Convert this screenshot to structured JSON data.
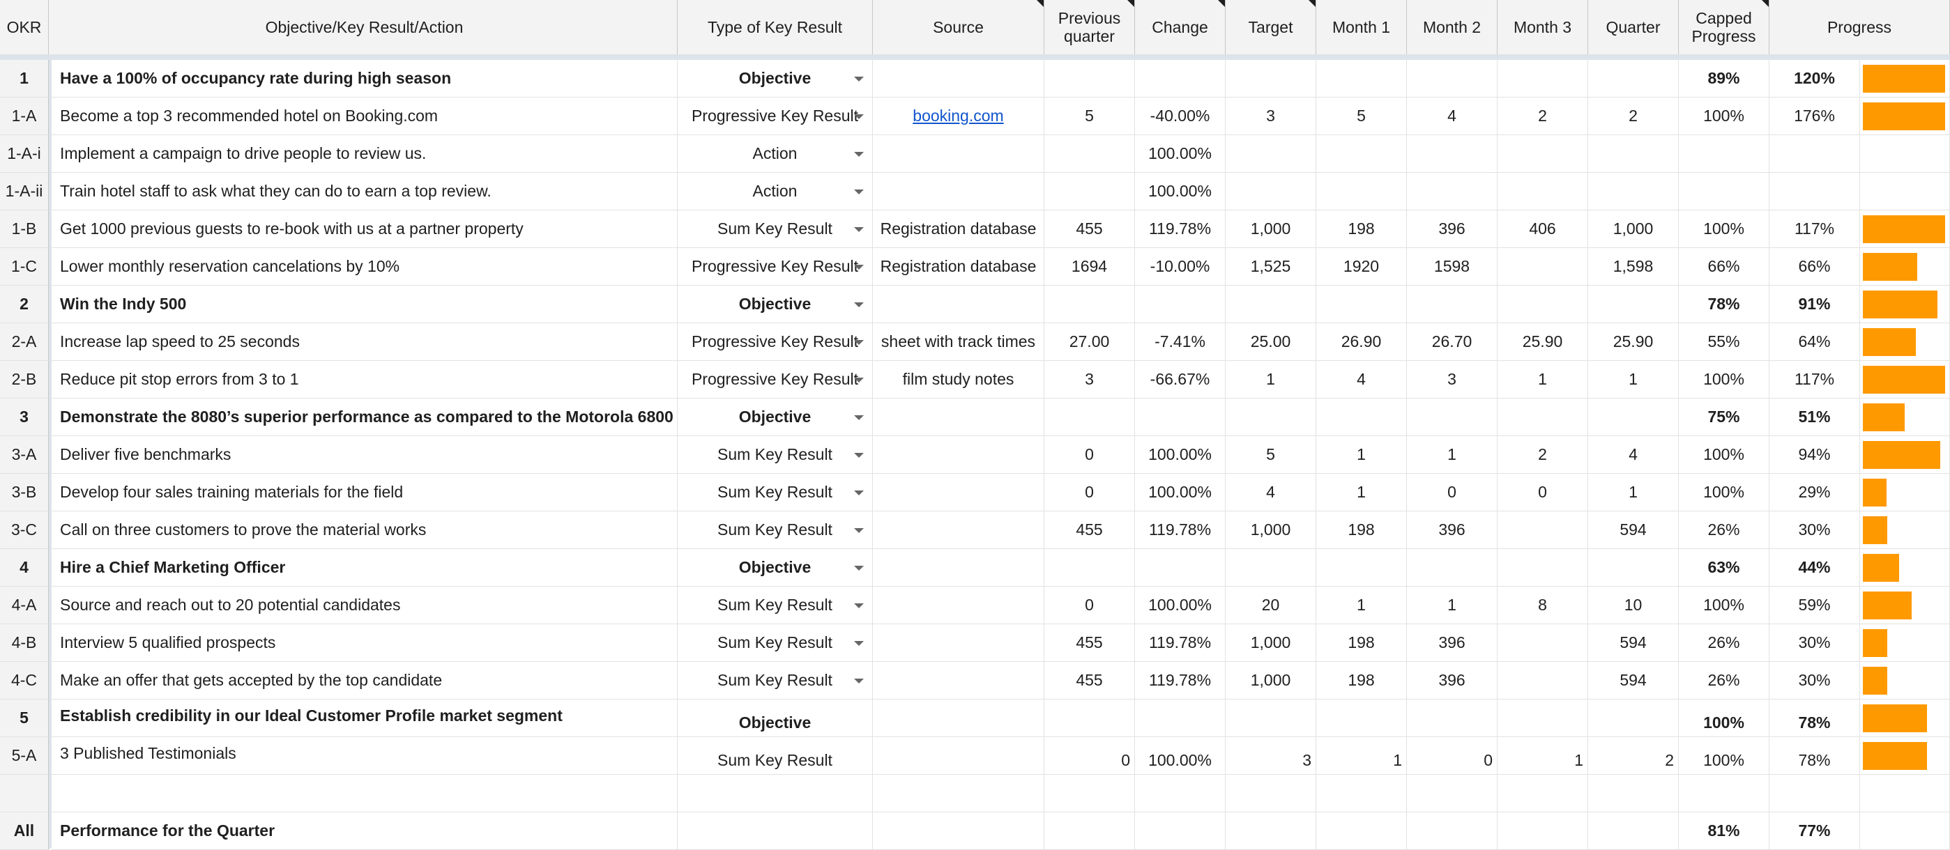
{
  "headers": {
    "okr": "OKR",
    "objective": "Objective/Key Result/Action",
    "type": "Type of Key Result",
    "source": "Source",
    "previous": "Previous\nquarter",
    "change": "Change",
    "target": "Target",
    "month1": "Month 1",
    "month2": "Month 2",
    "month3": "Month 3",
    "quarter": "Quarter",
    "capped": "Capped\nProgress",
    "progress": "Progress"
  },
  "rows": [
    {
      "id": "1",
      "name": "Have a 100% of occupancy rate during high season",
      "type": "Objective",
      "source": "",
      "prev": "",
      "change": "",
      "target": "",
      "m1": "",
      "m2": "",
      "m3": "",
      "quarter": "",
      "capped": "89%",
      "progress": "120%",
      "bar": 1.0
    },
    {
      "id": "1-A",
      "name": "Become a top 3 recommended hotel on Booking.com",
      "type": "Progressive Key Result",
      "source": "booking.com",
      "prev": "5",
      "change": "-40.00%",
      "target": "3",
      "m1": "5",
      "m2": "4",
      "m3": "2",
      "quarter": "2",
      "capped": "100%",
      "progress": "176%",
      "bar": 1.0
    },
    {
      "id": "1-A-i",
      "name": "Implement a campaign to drive people to review us.",
      "type": "Action",
      "source": "",
      "prev": "",
      "change": "100.00%",
      "target": "",
      "m1": "",
      "m2": "",
      "m3": "",
      "quarter": "",
      "capped": "",
      "progress": "",
      "bar": 0
    },
    {
      "id": "1-A-ii",
      "name": "Train hotel staff to ask what they can do to earn a top review.",
      "type": "Action",
      "source": "",
      "prev": "",
      "change": "100.00%",
      "target": "",
      "m1": "",
      "m2": "",
      "m3": "",
      "quarter": "",
      "capped": "",
      "progress": "",
      "bar": 0
    },
    {
      "id": "1-B",
      "name": "Get 1000 previous guests to re-book with us at a partner property",
      "type": "Sum Key Result",
      "source": "Registration database",
      "prev": "455",
      "change": "119.78%",
      "target": "1,000",
      "m1": "198",
      "m2": "396",
      "m3": "406",
      "quarter": "1,000",
      "capped": "100%",
      "progress": "117%",
      "bar": 1.0
    },
    {
      "id": "1-C",
      "name": "Lower monthly reservation cancelations by 10%",
      "type": "Progressive Key Result",
      "source": "Registration database",
      "prev": "1694",
      "change": "-10.00%",
      "target": "1,525",
      "m1": "1920",
      "m2": "1598",
      "m3": "",
      "quarter": "1,598",
      "capped": "66%",
      "progress": "66%",
      "bar": 0.66
    },
    {
      "id": "2",
      "name": "Win the Indy 500",
      "type": "Objective",
      "source": "",
      "prev": "",
      "change": "",
      "target": "",
      "m1": "",
      "m2": "",
      "m3": "",
      "quarter": "",
      "capped": "78%",
      "progress": "91%",
      "bar": 0.91
    },
    {
      "id": "2-A",
      "name": "Increase lap speed to 25 seconds",
      "type": "Progressive Key Result",
      "source": "sheet with track times",
      "prev": "27.00",
      "change": "-7.41%",
      "target": "25.00",
      "m1": "26.90",
      "m2": "26.70",
      "m3": "25.90",
      "quarter": "25.90",
      "capped": "55%",
      "progress": "64%",
      "bar": 0.64
    },
    {
      "id": "2-B",
      "name": "Reduce pit stop errors from 3 to 1",
      "type": "Progressive Key Result",
      "source": "film study notes",
      "prev": "3",
      "change": "-66.67%",
      "target": "1",
      "m1": "4",
      "m2": "3",
      "m3": "1",
      "quarter": "1",
      "capped": "100%",
      "progress": "117%",
      "bar": 1.0
    },
    {
      "id": "3",
      "name": "Demonstrate the 8080’s superior performance as compared to the Motorola 6800",
      "type": "Objective",
      "source": "",
      "prev": "",
      "change": "",
      "target": "",
      "m1": "",
      "m2": "",
      "m3": "",
      "quarter": "",
      "capped": "75%",
      "progress": "51%",
      "bar": 0.51
    },
    {
      "id": "3-A",
      "name": "Deliver five benchmarks",
      "type": "Sum Key Result",
      "source": "",
      "prev": "0",
      "change": "100.00%",
      "target": "5",
      "m1": "1",
      "m2": "1",
      "m3": "2",
      "quarter": "4",
      "capped": "100%",
      "progress": "94%",
      "bar": 0.94
    },
    {
      "id": "3-B",
      "name": "Develop four sales training materials for the field",
      "type": "Sum Key Result",
      "source": "",
      "prev": "0",
      "change": "100.00%",
      "target": "4",
      "m1": "1",
      "m2": "0",
      "m3": "0",
      "quarter": "1",
      "capped": "100%",
      "progress": "29%",
      "bar": 0.29
    },
    {
      "id": "3-C",
      "name": "Call on three customers to prove the material works",
      "type": "Sum Key Result",
      "source": "",
      "prev": "455",
      "change": "119.78%",
      "target": "1,000",
      "m1": "198",
      "m2": "396",
      "m3": "",
      "quarter": "594",
      "capped": "26%",
      "progress": "30%",
      "bar": 0.3
    },
    {
      "id": "4",
      "name": "Hire a Chief Marketing Officer",
      "type": "Objective",
      "source": "",
      "prev": "",
      "change": "",
      "target": "",
      "m1": "",
      "m2": "",
      "m3": "",
      "quarter": "",
      "capped": "63%",
      "progress": "44%",
      "bar": 0.44
    },
    {
      "id": "4-A",
      "name": "Source and reach out to 20 potential candidates",
      "type": "Sum Key Result",
      "source": "",
      "prev": "0",
      "change": "100.00%",
      "target": "20",
      "m1": "1",
      "m2": "1",
      "m3": "8",
      "quarter": "10",
      "capped": "100%",
      "progress": "59%",
      "bar": 0.59
    },
    {
      "id": "4-B",
      "name": "Interview 5 qualified prospects",
      "type": "Sum Key Result",
      "source": "",
      "prev": "455",
      "change": "119.78%",
      "target": "1,000",
      "m1": "198",
      "m2": "396",
      "m3": "",
      "quarter": "594",
      "capped": "26%",
      "progress": "30%",
      "bar": 0.3
    },
    {
      "id": "4-C",
      "name": "Make an offer that gets accepted by the top candidate",
      "type": "Sum Key Result",
      "source": "",
      "prev": "455",
      "change": "119.78%",
      "target": "1,000",
      "m1": "198",
      "m2": "396",
      "m3": "",
      "quarter": "594",
      "capped": "26%",
      "progress": "30%",
      "bar": 0.3
    },
    {
      "id": "5",
      "name": "Establish credibility in our Ideal Customer Profile market segment",
      "type": "Objective",
      "source": "",
      "prev": "",
      "change": "",
      "target": "",
      "m1": "",
      "m2": "",
      "m3": "",
      "quarter": "",
      "capped": "100%",
      "progress": "78%",
      "bar": 0.78
    },
    {
      "id": "5-A",
      "name": "3 Published Testimonials",
      "type": "Sum Key Result",
      "source": "",
      "prev": "0",
      "change": "100.00%",
      "target": "3",
      "m1": "1",
      "m2": "0",
      "m3": "1",
      "quarter": "2",
      "capped": "100%",
      "progress": "78%",
      "bar": 0.78
    },
    {
      "id": "",
      "name": "",
      "type": "",
      "source": "",
      "prev": "",
      "change": "",
      "target": "",
      "m1": "",
      "m2": "",
      "m3": "",
      "quarter": "",
      "capped": "",
      "progress": "",
      "bar": 0
    },
    {
      "id": "All",
      "name": "Performance for the Quarter",
      "type": "",
      "source": "",
      "prev": "",
      "change": "",
      "target": "",
      "m1": "",
      "m2": "",
      "m3": "",
      "quarter": "",
      "capped": "81%",
      "progress": "77%",
      "bar": 0
    }
  ],
  "colors": {
    "bar": "#ff9900",
    "header_bg": "#f3f3f3",
    "link": "#1155cc"
  }
}
